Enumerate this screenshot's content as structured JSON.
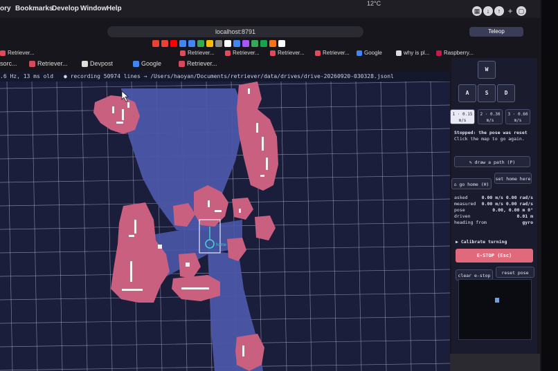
{
  "menubar": {
    "items": [
      "ory",
      "Bookmarks",
      "Develop",
      "Window",
      "Help"
    ],
    "weather": "12°C"
  },
  "browser": {
    "url": "localhost:8791",
    "favicon_colors": [
      "#e94235",
      "#ea4335",
      "#ff0000",
      "#4285f4",
      "#4285f4",
      "#34a853",
      "#fbbc04",
      "#888888",
      "#ffffff",
      "#4285f4",
      "#a855f7",
      "#34a853",
      "#16a34a",
      "#f97316",
      "#ffffff"
    ],
    "bookmarks": [
      "Retriever...",
      "Retriever...",
      "Retriever...",
      "Retriever...",
      "Retriever...",
      "Google",
      "why is pl...",
      "Raspberry...",
      "Teleop"
    ],
    "tabs": [
      "sorc...",
      "Retriever...",
      "Devpost",
      "Google",
      "Retriever...",
      "Retriever...",
      "Retriever...",
      "Retriever...",
      "Retriever...",
      "Retriever..."
    ]
  },
  "status": {
    "rate": ".6 Hz, 13 ms old",
    "recording": "● recording 50974 lines → /Users/haoyan/Documents/retriever/data/drives/drive-20260920-030328.jsonl"
  },
  "map": {
    "robot_label": "home",
    "colors": {
      "background": "#1b1e3a",
      "grid": "#c9cce6",
      "free": "#4b57a8",
      "obstacle": "#c9607f",
      "occupied": "#f2f2f2",
      "robot": "#3fd0d0"
    }
  },
  "panel": {
    "keys": {
      "w": "W",
      "a": "A",
      "s": "S",
      "d": "D"
    },
    "speeds": [
      {
        "label": "1 · 0.15",
        "unit": "m/s",
        "active": true
      },
      {
        "label": "2 · 0.30",
        "unit": "m/s",
        "active": false
      },
      {
        "label": "3 · 0.60",
        "unit": "m/s",
        "active": false
      }
    ],
    "message_title": "Stopped: the pose was reset",
    "message_body": "Click the map to go again.",
    "draw_path": "✎ draw a path (P)",
    "go_home": "⌂ go home (H)",
    "set_home": "set home here",
    "stats": [
      {
        "key": "asked",
        "value": "0.00 m/s 0.00 rad/s"
      },
      {
        "key": "measured",
        "value": "0.00 m/s 0.00 rad/s"
      },
      {
        "key": "pose",
        "value": "0.00, 0.00 m 0°"
      },
      {
        "key": "driven",
        "value": "0.01 m"
      },
      {
        "key": "heading from",
        "value": "gyro"
      }
    ],
    "calibrate": "▶ Calibrate turning",
    "estop": "E-STOP (Esc)",
    "clear_estop": "clear e-stop",
    "reset_pose": "reset pose (R)"
  }
}
